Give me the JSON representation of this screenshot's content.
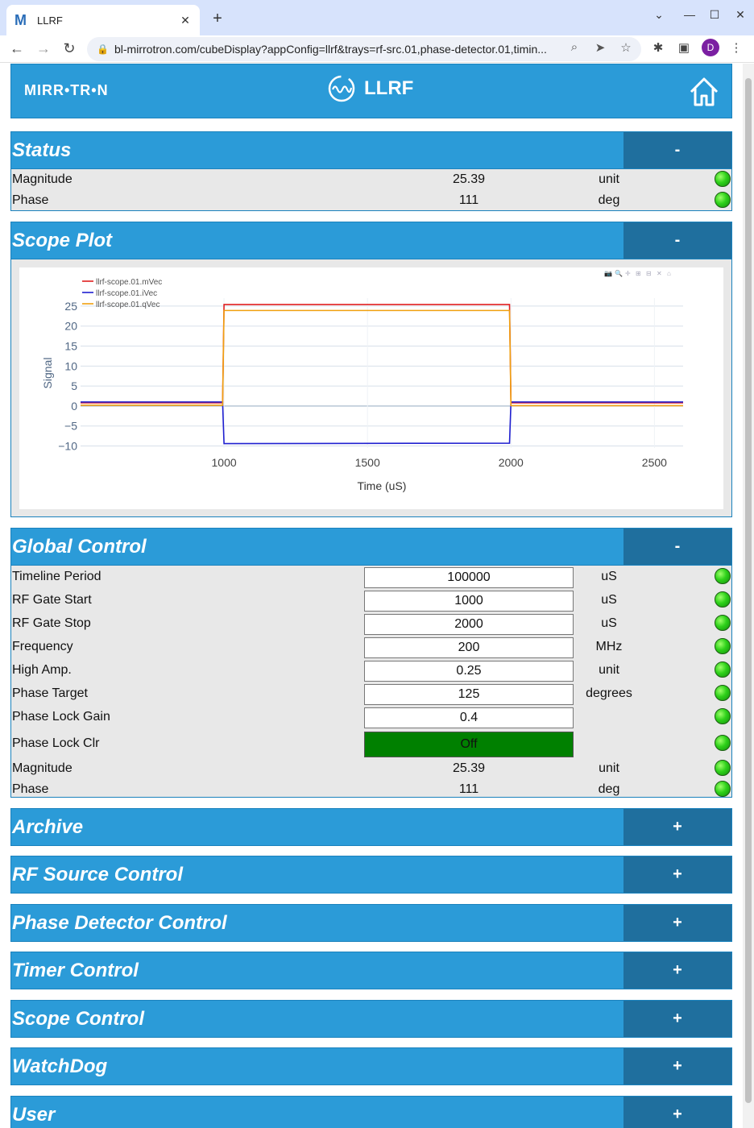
{
  "browser": {
    "tab_title": "LLRF",
    "tab_favicon": "M",
    "url": "bl-mirrotron.com/cubeDisplay?appConfig=llrf&trays=rf-src.01,phase-detector.01,timin...",
    "profile_initial": "D"
  },
  "header": {
    "logo_text": "MIRR•TR•N",
    "app_name": "LLRF"
  },
  "status": {
    "title": "Status",
    "toggle": "-",
    "rows": [
      {
        "label": "Magnitude",
        "value": "25.39",
        "unit": "unit"
      },
      {
        "label": "Phase",
        "value": "111",
        "unit": "deg"
      }
    ]
  },
  "scope": {
    "title": "Scope Plot",
    "toggle": "-"
  },
  "chart_data": {
    "type": "line",
    "title": "",
    "xlabel": "Time (uS)",
    "ylabel": "Signal",
    "xlim": [
      500,
      2600
    ],
    "ylim": [
      -10.5,
      27
    ],
    "xticks": [
      1000,
      1500,
      2000,
      2500
    ],
    "yticks": [
      -10,
      -5,
      0,
      5,
      10,
      15,
      20,
      25
    ],
    "grid": true,
    "legend_position": "top-left",
    "series": [
      {
        "name": "llrf-scope.01.mVec",
        "color": "#e02020",
        "x": [
          500,
          995,
          1000,
          1995,
          2000,
          2600
        ],
        "y": [
          0.8,
          0.8,
          25.4,
          25.4,
          0.8,
          0.8
        ]
      },
      {
        "name": "llrf-scope.01.iVec",
        "color": "#2020d0",
        "x": [
          500,
          995,
          1000,
          1995,
          2000,
          2600
        ],
        "y": [
          1.0,
          1.0,
          -9.4,
          -9.3,
          1.0,
          1.0
        ]
      },
      {
        "name": "llrf-scope.01.qVec",
        "color": "#f0a010",
        "x": [
          500,
          995,
          1000,
          1995,
          2000,
          2600
        ],
        "y": [
          0.2,
          0.2,
          23.9,
          23.9,
          0.1,
          0.1
        ]
      }
    ]
  },
  "global": {
    "title": "Global Control",
    "toggle": "-",
    "inputs": [
      {
        "label": "Timeline Period",
        "value": "100000",
        "unit": "uS"
      },
      {
        "label": "RF Gate Start",
        "value": "1000",
        "unit": "uS"
      },
      {
        "label": "RF Gate Stop",
        "value": "2000",
        "unit": "uS"
      },
      {
        "label": "Frequency",
        "value": "200",
        "unit": "MHz"
      },
      {
        "label": "High Amp.",
        "value": "0.25",
        "unit": "unit"
      },
      {
        "label": "Phase Target",
        "value": "125",
        "unit": "degrees"
      },
      {
        "label": "Phase Lock Gain",
        "value": "0.4",
        "unit": ""
      }
    ],
    "lock_clr": {
      "label": "Phase Lock Clr",
      "value": "Off"
    },
    "readouts": [
      {
        "label": "Magnitude",
        "value": "25.39",
        "unit": "unit"
      },
      {
        "label": "Phase",
        "value": "111",
        "unit": "deg"
      }
    ]
  },
  "collapsed": [
    {
      "title": "Archive",
      "toggle": "+"
    },
    {
      "title": "RF Source Control",
      "toggle": "+"
    },
    {
      "title": "Phase Detector Control",
      "toggle": "+"
    },
    {
      "title": "Timer Control",
      "toggle": "+"
    },
    {
      "title": "Scope Control",
      "toggle": "+"
    },
    {
      "title": "WatchDog",
      "toggle": "+"
    },
    {
      "title": "User",
      "toggle": "+"
    }
  ]
}
